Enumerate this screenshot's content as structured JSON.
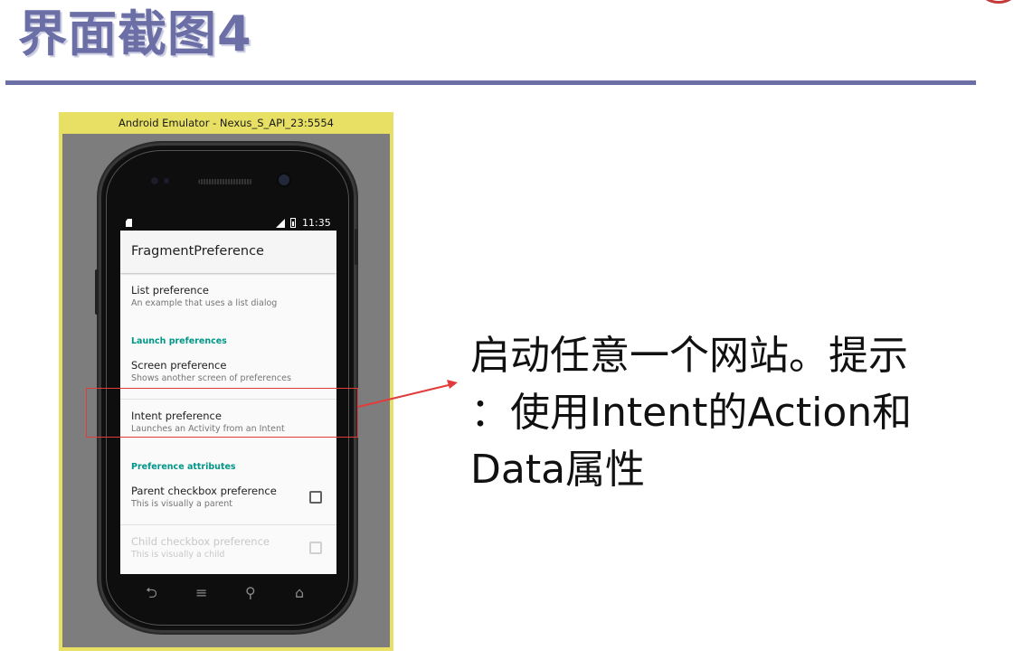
{
  "slide": {
    "title": "界面截图4",
    "callout_lines": [
      "启动任意一个网站。提示",
      "：使用Intent的Action和",
      "Data属性"
    ]
  },
  "emulator": {
    "window_title": "Android Emulator - Nexus_S_API_23:5554"
  },
  "status_bar": {
    "time": "11:35"
  },
  "app": {
    "title": "FragmentPreference",
    "list_pref": {
      "title": "List preference",
      "summary": "An example that uses a list dialog"
    },
    "launch_category": "Launch preferences",
    "screen_pref": {
      "title": "Screen preference",
      "summary": "Shows another screen of preferences"
    },
    "intent_pref": {
      "title": "Intent preference",
      "summary": "Launches an Activity from an Intent"
    },
    "attributes_category": "Preference attributes",
    "parent_checkbox": {
      "title": "Parent checkbox preference",
      "summary": "This is visually a parent",
      "checked": false
    },
    "child_checkbox": {
      "title": "Child checkbox preference",
      "summary": "This is visually a child",
      "checked": false,
      "enabled": false
    }
  },
  "nav_keys": {
    "back": "⮌",
    "menu": "≡",
    "search": "⚲",
    "home": "⌂"
  },
  "colors": {
    "title": "#6b6fa6",
    "accent": "#009688",
    "highlight": "#e23b3b",
    "emulator_frame": "#e7e064"
  }
}
